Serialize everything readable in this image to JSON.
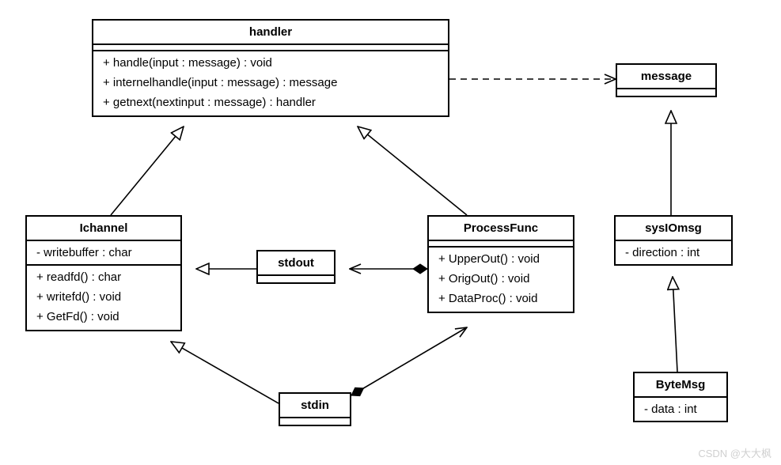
{
  "classes": {
    "handler": {
      "name": "handler",
      "operations": [
        "+ handle(input : message) : void",
        "+ internelhandle(input : message) : message",
        "+ getnext(nextinput : message) : handler"
      ]
    },
    "message": {
      "name": "message"
    },
    "ichannel": {
      "name": "Ichannel",
      "attributes": [
        "- writebuffer : char"
      ],
      "operations": [
        "+ readfd() : char",
        "+ writefd() : void",
        "+ GetFd() : void"
      ]
    },
    "stdout": {
      "name": "stdout"
    },
    "processfunc": {
      "name": "ProcessFunc",
      "operations": [
        "+ UpperOut() : void",
        "+ OrigOut() : void",
        "+ DataProc() : void"
      ]
    },
    "sysiomsg": {
      "name": "sysIOmsg",
      "attributes": [
        "- direction : int"
      ]
    },
    "stdin": {
      "name": "stdin"
    },
    "bytemsg": {
      "name": "ByteMsg",
      "attributes": [
        "- data : int"
      ]
    }
  },
  "watermark": "CSDN @大大枫"
}
